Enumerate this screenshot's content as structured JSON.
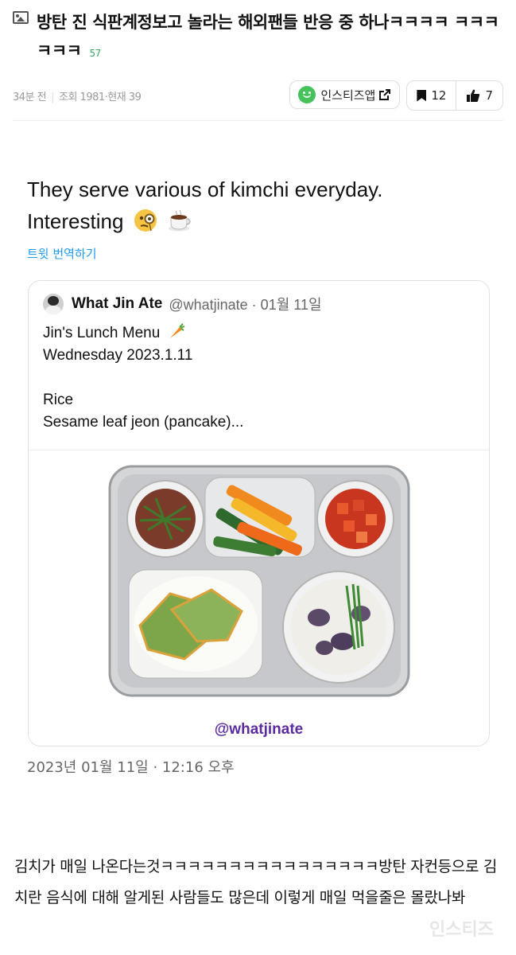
{
  "post": {
    "title": "방탄 진 식판계정보고 놀라는 해외팬들 반응 중 하나ㅋㅋㅋㅋ ㅋㅋㅋㅋㅋㅋ",
    "comment_count": "57",
    "time": "34분 전",
    "views": "조회 1981",
    "current": "현재 39",
    "app_button": "인스티즈앱",
    "bookmark_count": "12",
    "like_count": "7"
  },
  "tweet": {
    "text_line1": "They serve various of kimchi everyday.",
    "text_line2": "Interesting",
    "translate_label": "트윗 번역하기",
    "date": "2023년 01월 11일 · 12:16 오후"
  },
  "quote": {
    "name": "What Jin Ate",
    "handle": "@whatjinate · 01월 11일",
    "line1": "Jin's Lunch Menu",
    "line2": "Wednesday 2023.1.11",
    "line3": "Rice",
    "line4": "Sesame leaf jeon (pancake)...",
    "image_handle": "@whatjinate"
  },
  "comment": {
    "text": "김치가 매일 나온다는것ㅋㅋㅋㅋㅋㅋㅋㅋㅋㅋㅋㅋㅋㅋㅋㅋ방탄 자컨등으로 김치란 음식에 대해 알게된 사람들도 많은데 이렇게 매일 먹을줄은 몰랐나봐"
  },
  "watermark": "인스티즈",
  "colors": {
    "accent_green": "#3aaa5d",
    "link_blue": "#1d9bf0",
    "brand_purple": "#5a2ca0"
  },
  "icons": [
    "image-icon",
    "smile-icon",
    "external-link-icon",
    "bookmark-icon",
    "thumbs-up-icon",
    "monocle-face-icon",
    "coffee-icon",
    "carrot-icon"
  ]
}
